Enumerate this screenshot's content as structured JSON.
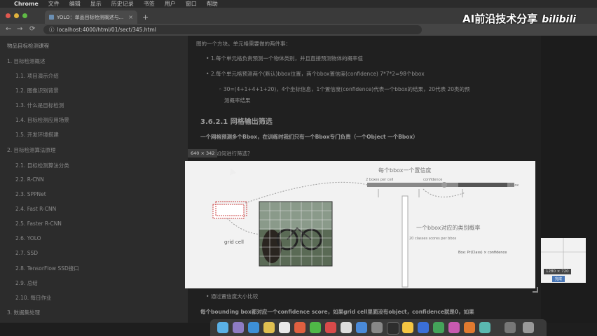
{
  "menubar": {
    "apple": "",
    "app": "Chrome",
    "items": [
      "文件",
      "编辑",
      "显示",
      "历史记录",
      "书签",
      "用户",
      "窗口",
      "帮助"
    ]
  },
  "tab": {
    "title": "YOLO：单品目标检测概述与...",
    "close": "×",
    "new": "+"
  },
  "address": {
    "back": "←",
    "forward": "→",
    "reload": "⟳",
    "url": "localhost:4000/html/01/sect/345.html"
  },
  "brand": {
    "text": "AI前沿技术分享",
    "logo": "bilibili"
  },
  "sidebar": {
    "title": "物品目标检测课程",
    "items": [
      "1. 目标检测概述",
      "1.1. 项目演示介绍",
      "1.2. 图像识别背景",
      "1.3. 什么是目标检测",
      "1.4. 目标检测应用场景",
      "1.5. 开发环境搭建",
      "2. 目标检测算法原理",
      "2.1. 目标检测算法分类",
      "2.2. R-CNN",
      "2.3. SPPNet",
      "2.4. Fast R-CNN",
      "2.5. Faster R-CNN",
      "2.6. YOLO",
      "2.7. SSD",
      "2.8. TensorFlow SSD接口",
      "2.9. 总结",
      "2.10. 每日作业",
      "3. 数据集处理"
    ]
  },
  "content": {
    "intro": "图的一个方块。单元格需要做的两件事：",
    "bullet1": "1.每个单元格负责预测一个物体类别，并且直接预测物体的概率值",
    "bullet2": "2.每个单元格预测两个(默认)bbox位置，两个bbox置信度(confidence) 7*7*2=98个bbox",
    "sub1": "30=(4+1+4+1+20)，4个坐标信息，1个置信度(confidence)代表一个bbox的结果，20代表 20类的预",
    "sub1b": "测概率结果",
    "heading": "3.6.2.1 网格输出筛选",
    "bold": "一个网格预测多个Bbox，在训练时我们只有一个Bbox专门负责（一个Object 一个Bbox）",
    "question": "如何进行筛选？",
    "badge": "640 × 342",
    "after_bullet": "通过置信度大小比较",
    "bottom": "每个bounding box都对应一个confidence score，如果grid cell里面没有object，confidence就是0，如果"
  },
  "figure": {
    "top_label": "每个bbox一个置信度",
    "bar_left": "2 boxes per cell",
    "bar_mid": "confidence",
    "bar_right": "bbox",
    "grid_cell": "grid cell",
    "class_label": "一个bbox对应的类别概率",
    "class_sub": "20 classes scores per bbox",
    "score": "Box: Pr(Class) × confidence"
  },
  "thumb": {
    "label": "1280 × 720",
    "button": "完成"
  },
  "colors": {
    "accent": "#4a78b8",
    "background": "#202020"
  }
}
